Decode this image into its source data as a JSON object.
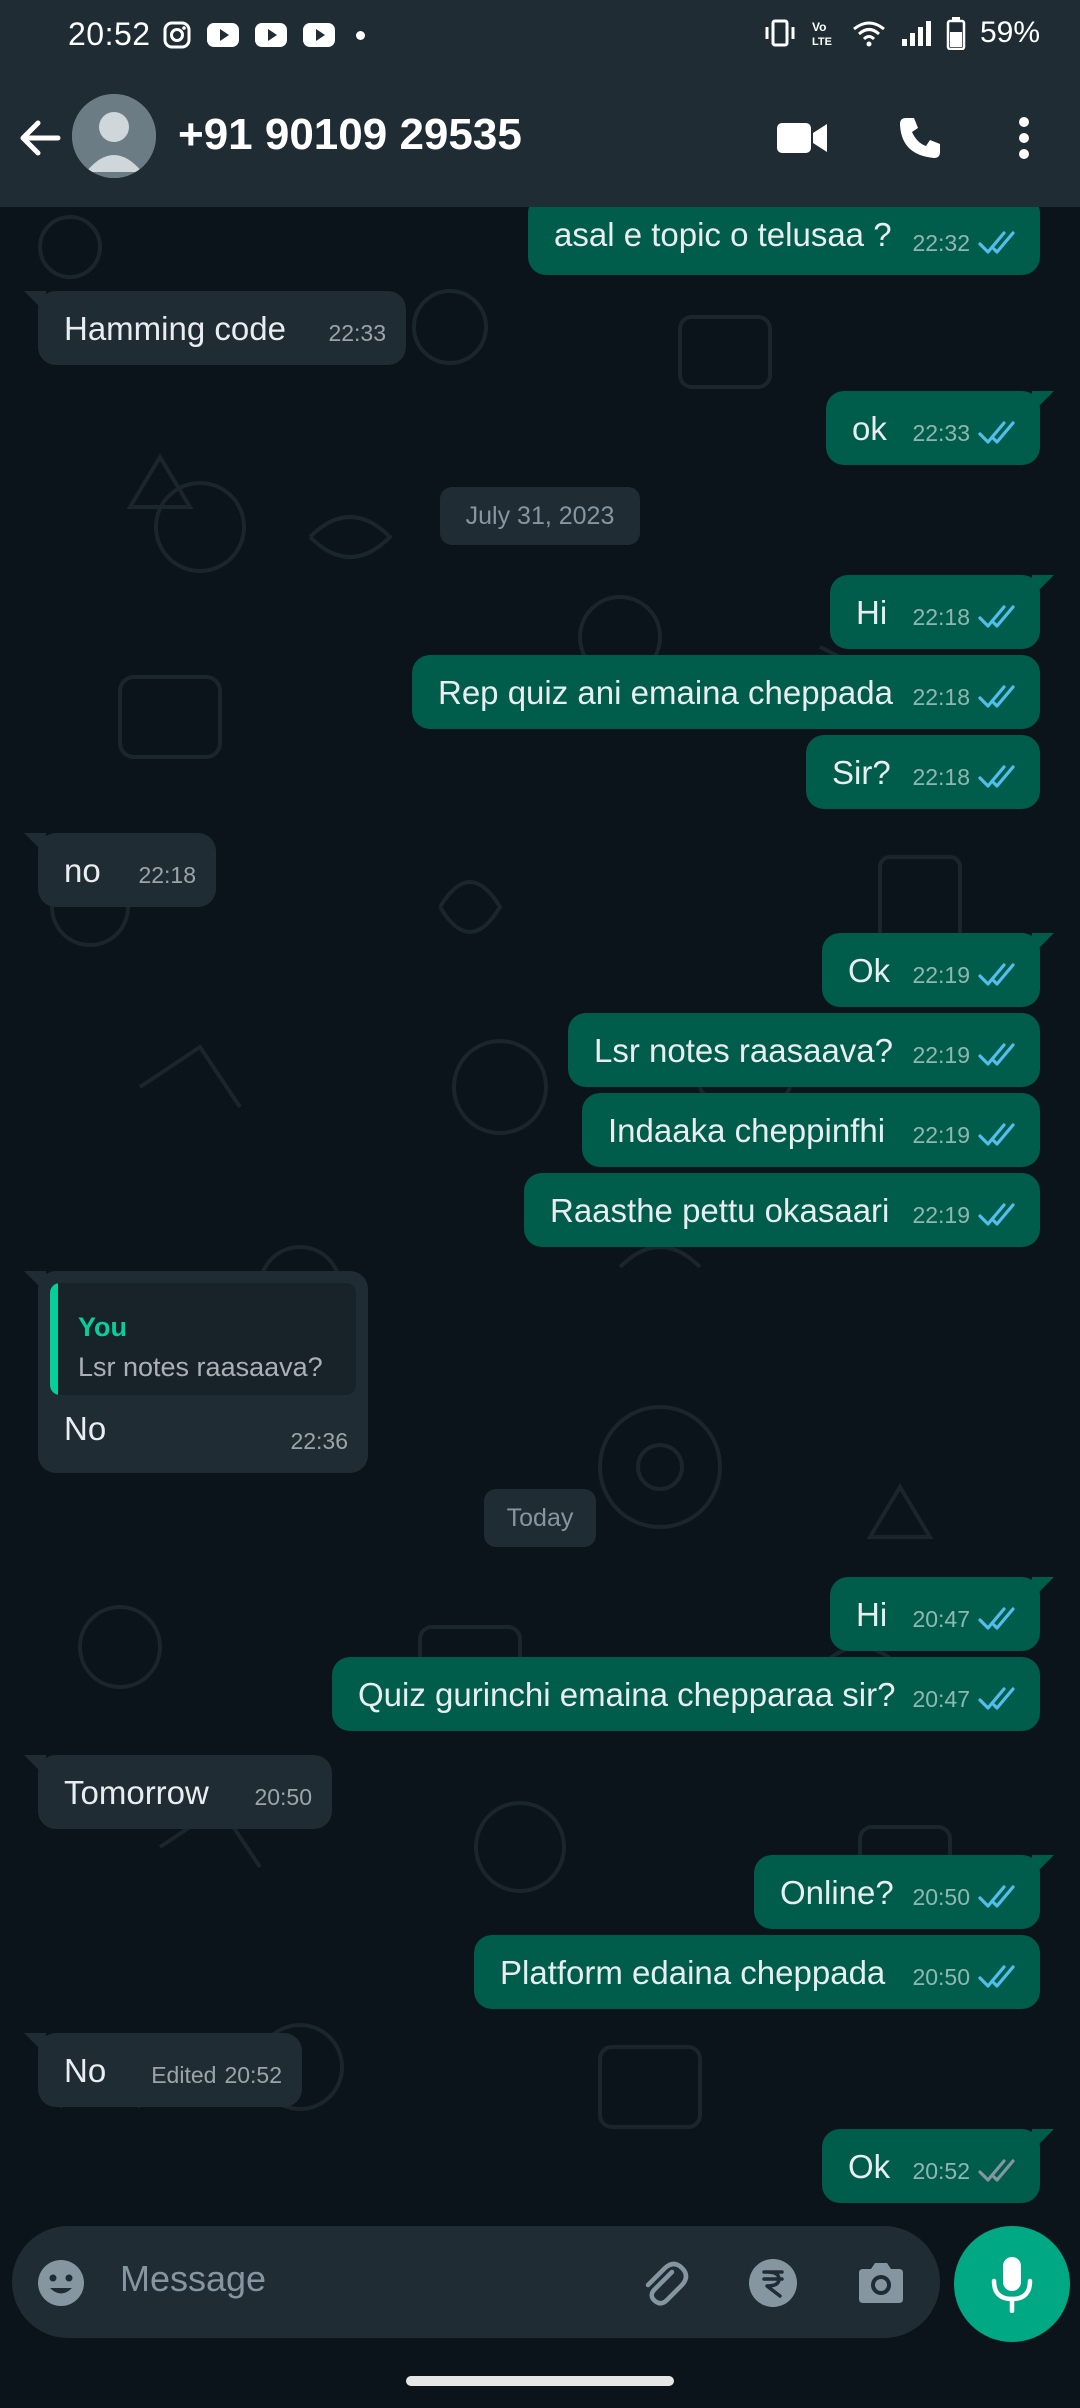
{
  "status_bar": {
    "time": "20:52",
    "battery": "59%"
  },
  "header": {
    "contact_name": "+91 90109 29535"
  },
  "messages": [
    {
      "id": "m1",
      "dir": "out",
      "text": "asal e topic o telusaa ?",
      "time": "22:32",
      "status": "read"
    },
    {
      "id": "m2",
      "dir": "in",
      "text": "Hamming code",
      "time": "22:33"
    },
    {
      "id": "m3",
      "dir": "out",
      "text": "ok",
      "time": "22:33",
      "status": "read"
    },
    {
      "id": "d1",
      "dir": "date",
      "text": "July 31, 2023"
    },
    {
      "id": "m4",
      "dir": "out",
      "text": "Hi",
      "time": "22:18",
      "status": "read"
    },
    {
      "id": "m5",
      "dir": "out",
      "text": "Rep quiz ani emaina cheppada",
      "time": "22:18",
      "status": "read"
    },
    {
      "id": "m6",
      "dir": "out",
      "text": "Sir?",
      "time": "22:18",
      "status": "read"
    },
    {
      "id": "m7",
      "dir": "in",
      "text": "no",
      "time": "22:18"
    },
    {
      "id": "m8",
      "dir": "out",
      "text": "Ok",
      "time": "22:19",
      "status": "read"
    },
    {
      "id": "m9",
      "dir": "out",
      "text": "Lsr notes raasaava?",
      "time": "22:19",
      "status": "read"
    },
    {
      "id": "m10",
      "dir": "out",
      "text": "Indaaka cheppinfhi",
      "time": "22:19",
      "status": "read"
    },
    {
      "id": "m11",
      "dir": "out",
      "text": "Raasthe pettu okasaari",
      "time": "22:19",
      "status": "read"
    },
    {
      "id": "m12",
      "dir": "in",
      "text": "No",
      "time": "22:36",
      "quote_name": "You",
      "quote_text": "Lsr notes raasaava?"
    },
    {
      "id": "d2",
      "dir": "date",
      "text": "Today"
    },
    {
      "id": "m13",
      "dir": "out",
      "text": "Hi",
      "time": "20:47",
      "status": "read"
    },
    {
      "id": "m14",
      "dir": "out",
      "text": "Quiz gurinchi emaina chepparaa sir?",
      "time": "20:47",
      "status": "read"
    },
    {
      "id": "m15",
      "dir": "in",
      "text": "Tomorrow",
      "time": "20:50"
    },
    {
      "id": "m16",
      "dir": "out",
      "text": "Online?",
      "time": "20:50",
      "status": "read"
    },
    {
      "id": "m17",
      "dir": "out",
      "text": "Platform edaina cheppada",
      "time": "20:50",
      "status": "read"
    },
    {
      "id": "m18",
      "dir": "in",
      "text": "No",
      "time": "20:52",
      "edited_label": "Edited"
    },
    {
      "id": "m19",
      "dir": "out",
      "text": "Ok",
      "time": "20:52",
      "status": "delivered"
    }
  ],
  "composer": {
    "placeholder": "Message"
  },
  "colors": {
    "outgoing_bubble": "#005c4b",
    "incoming_bubble": "#1f2c34",
    "accent": "#00a884",
    "read_tick": "#53bdeb",
    "delivered_tick": "#8696a0"
  }
}
